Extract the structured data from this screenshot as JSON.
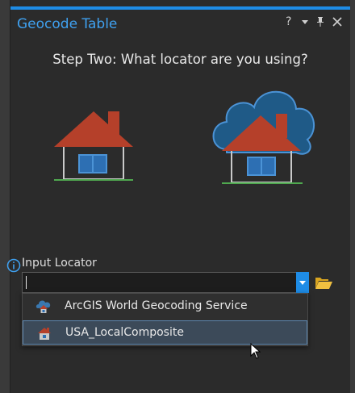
{
  "pane": {
    "title": "Geocode Table",
    "help": "?",
    "options": "▾",
    "pin": "📌",
    "close": "✕"
  },
  "step": {
    "heading": "Step Two: What locator are you using?"
  },
  "illustrations": {
    "local": "house-icon",
    "online": "cloud-house-icon"
  },
  "locator": {
    "label": "Input Locator",
    "value": "",
    "options": [
      {
        "label": "ArcGIS World Geocoding Service",
        "icon": "cloud-house-icon",
        "selected": false
      },
      {
        "label": "USA_LocalComposite",
        "icon": "house-icon",
        "selected": true
      }
    ]
  },
  "colors": {
    "accent": "#1e8ce6",
    "title": "#3fa1f0",
    "roof": "#b5402a",
    "cloud": "#1f5a87"
  }
}
